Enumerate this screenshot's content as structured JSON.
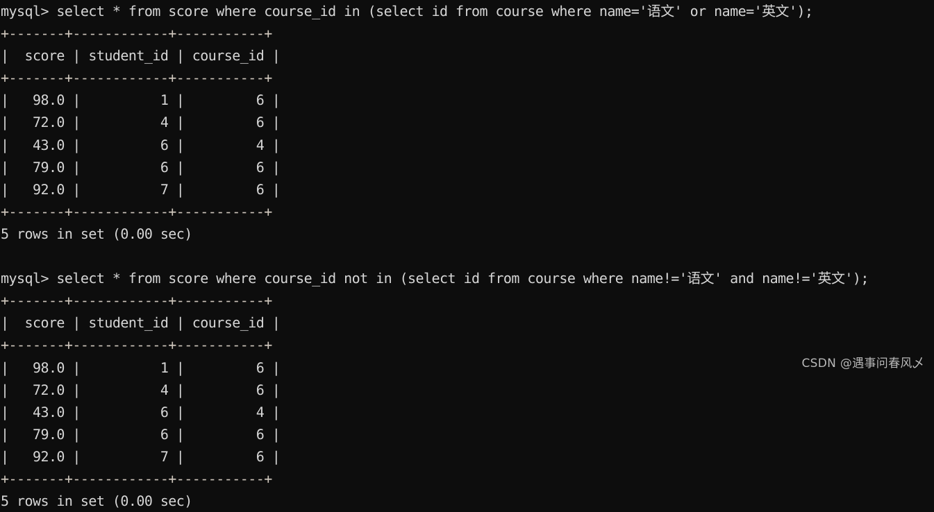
{
  "terminal": {
    "prompt": "mysql> ",
    "background_color": "#0d0d0d",
    "text_color": "#d6d6d6",
    "rule_color": "#cfc7bd",
    "separator": "+-------+------------+-----------+",
    "header_row": "|  score | student_id | course_id |",
    "columns": [
      "score",
      "student_id",
      "course_id"
    ],
    "blocks": [
      {
        "query": "mysql> select * from score where course_id in (select id from course where name='语文' or name='英文');",
        "rows": [
          "|   98.0 |          1 |         6 |",
          "|   72.0 |          4 |         6 |",
          "|   43.0 |          6 |         4 |",
          "|   79.0 |          6 |         6 |",
          "|   92.0 |          7 |         6 |"
        ],
        "row_values": [
          [
            "98.0",
            "1",
            "6"
          ],
          [
            "72.0",
            "4",
            "6"
          ],
          [
            "43.0",
            "6",
            "4"
          ],
          [
            "79.0",
            "6",
            "6"
          ],
          [
            "92.0",
            "7",
            "6"
          ]
        ],
        "status": "5 rows in set (0.00 sec)"
      },
      {
        "query": "mysql> select * from score where course_id not in (select id from course where name!='语文' and name!='英文');",
        "rows": [
          "|   98.0 |          1 |         6 |",
          "|   72.0 |          4 |         6 |",
          "|   43.0 |          6 |         4 |",
          "|   79.0 |          6 |         6 |",
          "|   92.0 |          7 |         6 |"
        ],
        "row_values": [
          [
            "98.0",
            "1",
            "6"
          ],
          [
            "72.0",
            "4",
            "6"
          ],
          [
            "43.0",
            "6",
            "4"
          ],
          [
            "79.0",
            "6",
            "6"
          ],
          [
            "92.0",
            "7",
            "6"
          ]
        ],
        "status": "5 rows in set (0.00 sec)"
      }
    ],
    "blank_line": " "
  },
  "watermark": {
    "text": "CSDN @遇事问春风乄"
  }
}
